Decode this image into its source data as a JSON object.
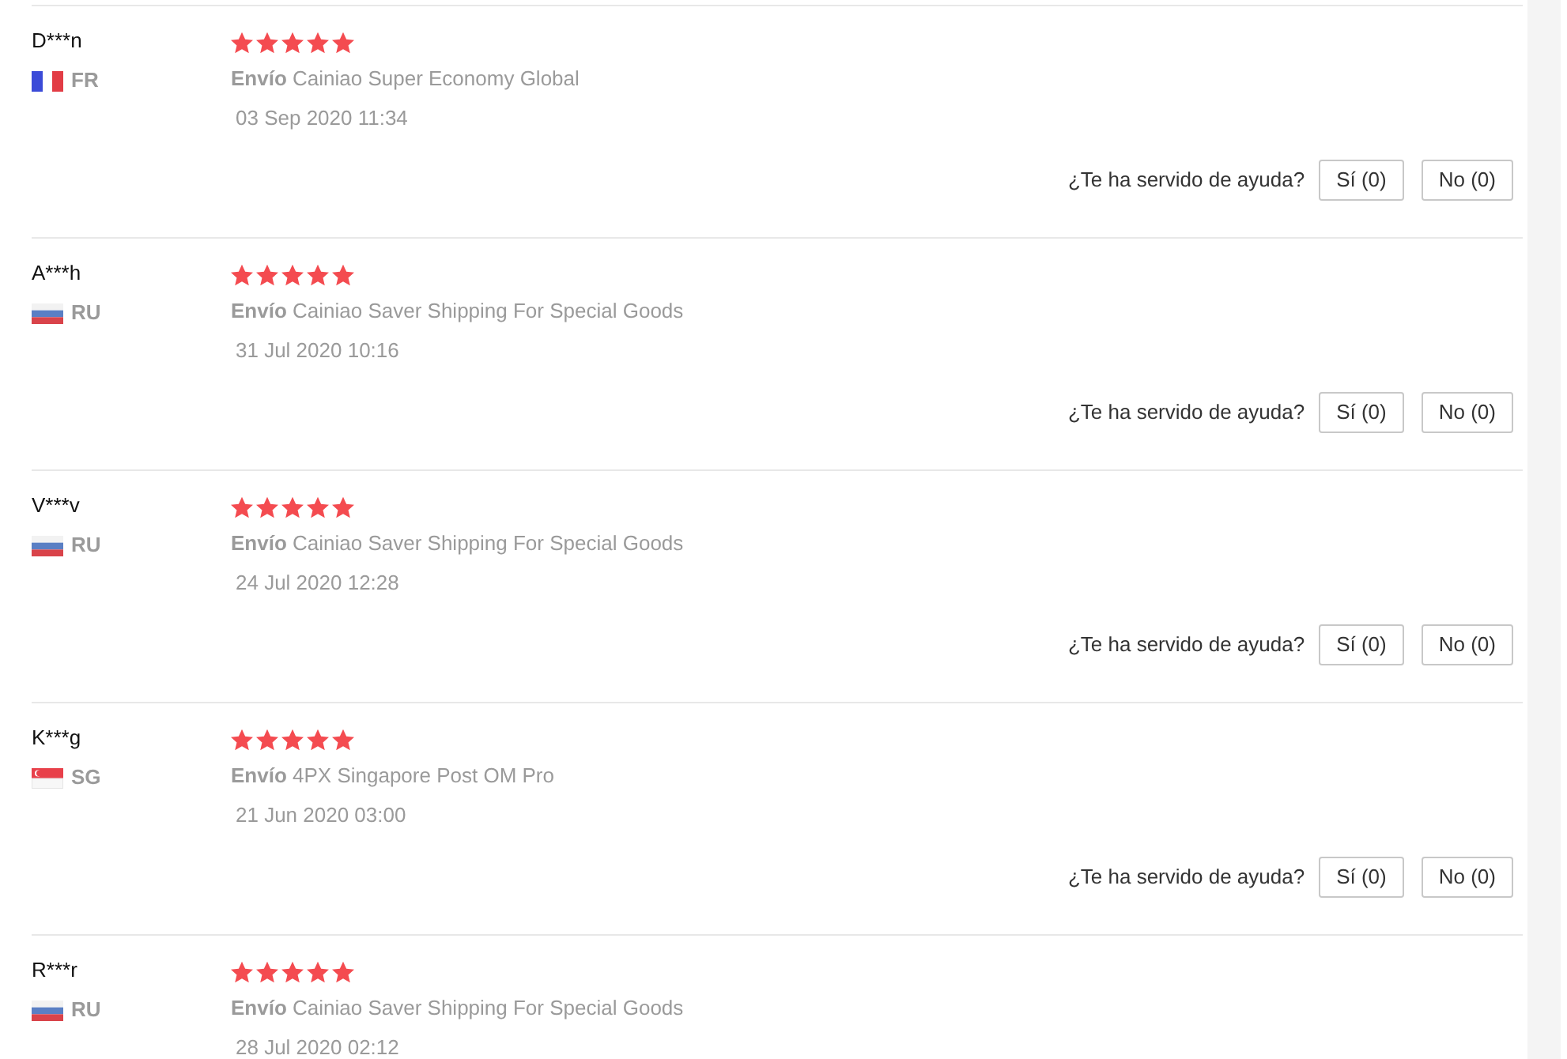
{
  "reviews": [
    {
      "name": "D***n",
      "kind": "fr",
      "country": "FR",
      "stars": 5,
      "shipping": "**Envío** Cainiao Super Economy Global",
      "date": "03 Sep 2020 11:34",
      "helpful": {
        "prompt": "¿Te ha servido de ayuda?",
        "buttons": [
          "Sí (0)",
          "No (0)"
        ]
      }
    },
    {
      "name": "A***h",
      "kind": "ru",
      "country": "RU",
      "stars": 5,
      "shipping": "**Envío** Cainiao Saver Shipping For Special Goods",
      "date": "31 Jul 2020 10:16",
      "helpful": {
        "prompt": "¿Te ha servido de ayuda?",
        "buttons": [
          "Sí (0)",
          "No (0)"
        ]
      }
    },
    {
      "name": "V***v",
      "kind": "ru",
      "country": "RU",
      "stars": 5,
      "shipping": "**Envío** Cainiao Saver Shipping For Special Goods",
      "date": "24 Jul 2020 12:28",
      "helpful": {
        "prompt": "¿Te ha servido de ayuda?",
        "buttons": [
          "Sí (0)",
          "No (0)"
        ]
      }
    },
    {
      "name": "K***g",
      "kind": "sg",
      "country": "SG",
      "stars": 5,
      "shipping": "**Envío** 4PX Singapore Post OM Pro",
      "date": "21 Jun 2020 03:00",
      "helpful": {
        "prompt": "¿Te ha servido de ayuda?",
        "buttons": [
          "Sí (0)",
          "No (0)"
        ]
      }
    },
    {
      "name": "R***r",
      "kind": "ru",
      "country": "RU",
      "stars": 5,
      "shipping": "**Envío** Cainiao Saver Shipping For Special Goods",
      "date": "28 Jul 2020 02:12"
    }
  ]
}
